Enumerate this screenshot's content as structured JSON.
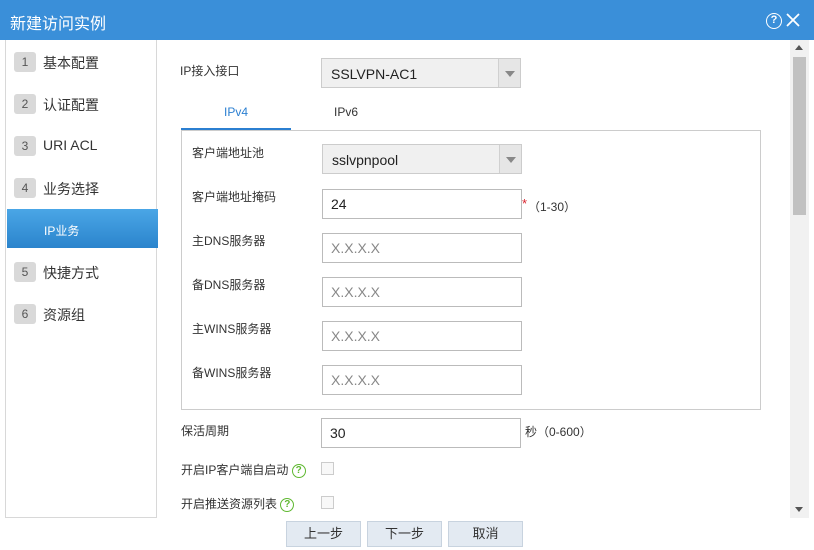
{
  "dialog": {
    "title": "新建访问实例",
    "help_icon": "help-icon",
    "close_icon": "close-icon"
  },
  "sidebar": {
    "items": [
      {
        "num": "1",
        "label": "基本配置"
      },
      {
        "num": "2",
        "label": "认证配置"
      },
      {
        "num": "3",
        "label": "URI ACL"
      },
      {
        "num": "4",
        "label": "业务选择"
      },
      {
        "num": "",
        "label": "IP业务"
      },
      {
        "num": "5",
        "label": "快捷方式"
      },
      {
        "num": "6",
        "label": "资源组"
      }
    ],
    "active_index": 4
  },
  "form": {
    "ip_interface_label": "IP接入接口",
    "ip_interface_value": "SSLVPN-AC1",
    "tabs": [
      {
        "label": "IPv4"
      },
      {
        "label": "IPv6"
      }
    ],
    "active_tab": 0,
    "pool_label": "客户端地址池",
    "pool_value": "sslvpnpool",
    "mask_label": "客户端地址掩码",
    "mask_value": "24",
    "mask_required": "*",
    "mask_hint": "（1-30）",
    "dns1_label": "主DNS服务器",
    "dns1_placeholder": "X.X.X.X",
    "dns2_label": "备DNS服务器",
    "dns2_placeholder": "X.X.X.X",
    "wins1_label": "主WINS服务器",
    "wins1_placeholder": "X.X.X.X",
    "wins2_label": "备WINS服务器",
    "wins2_placeholder": "X.X.X.X",
    "keepalive_label": "保活周期",
    "keepalive_value": "30",
    "keepalive_hint": "秒（0-600）",
    "autostart_label": "开启IP客户端自启动",
    "push_label": "开启推送资源列表",
    "help_glyph": "?"
  },
  "footer": {
    "prev_label": "上一步",
    "next_label": "下一步",
    "cancel_label": "取消"
  },
  "colors": {
    "titlebar": "#3a8fd9",
    "active_nav": "#2b84cc",
    "tab_active": "#2b7fd1",
    "required": "#d9232d",
    "help_green": "#5fb831"
  }
}
